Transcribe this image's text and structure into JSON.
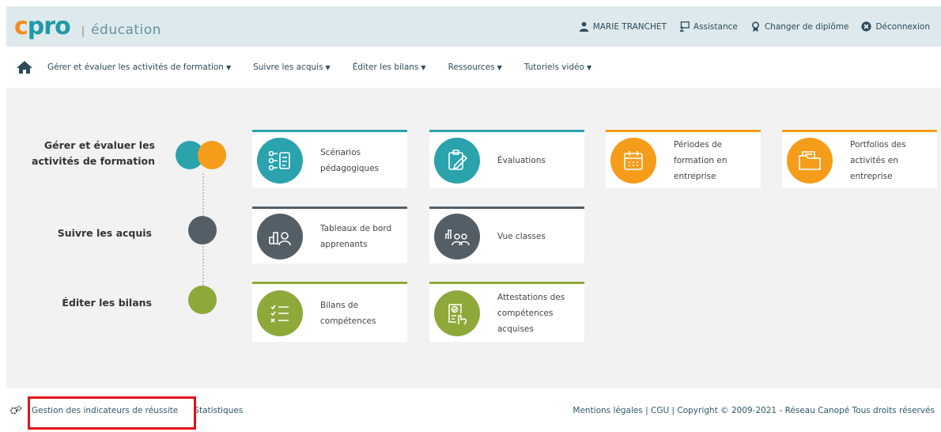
{
  "header": {
    "logo_text": "cpro",
    "logo_separator": "|",
    "logo_subtitle": "éducation",
    "user_name": "MARIE TRANCHET",
    "assistance": "Assistance",
    "changer": "Changer de diplôme",
    "deconnexion": "Déconnexion"
  },
  "nav": {
    "items": [
      {
        "label": "Gérer et évaluer les activités de formation"
      },
      {
        "label": "Suivre les acquis"
      },
      {
        "label": "Éditer les bilans"
      },
      {
        "label": "Ressources"
      },
      {
        "label": "Tutoriels vidéo"
      }
    ]
  },
  "rows": [
    {
      "label": "Gérer et évaluer les activités de formation"
    },
    {
      "label": "Suivre les acquis"
    },
    {
      "label": "Éditer les bilans"
    }
  ],
  "cards": {
    "scenarios": "Scénarios pédagogiques",
    "evaluations": "Évaluations",
    "periodes": "Périodes de formation en entreprise",
    "portfolios": "Portfolios des activités en entreprise",
    "tableaux": "Tableaux de bord apprenants",
    "vue_classes": "Vue classes",
    "bilans": "Bilans de compétences",
    "attestations": "Attestations des compétences acquises"
  },
  "colors": {
    "teal": "#2aa3ad",
    "orange": "#f59d1a",
    "gray": "#535e66",
    "olive": "#8ea83a",
    "logo_c": "#f38d1c",
    "logo_pro": "#1f9aa4"
  },
  "footer": {
    "gestion": "Gestion des indicateurs de réussite",
    "statistiques": "Statistiques",
    "legal": "Mentions légales | CGU | Copyright © 2009-2021 - Réseau Canopé Tous droits réservés"
  }
}
